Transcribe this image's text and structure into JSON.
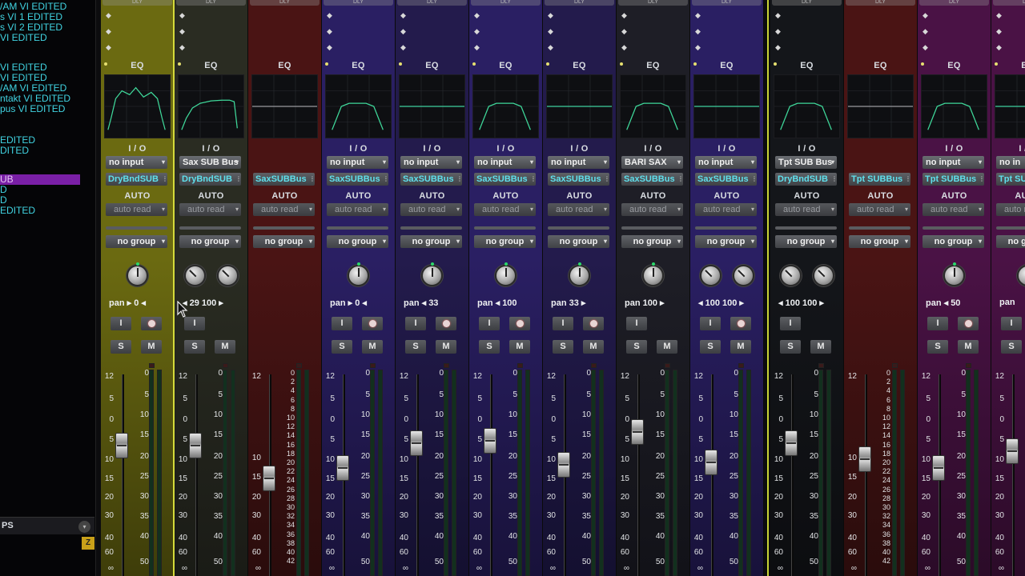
{
  "track_list": {
    "items": [
      {
        "label": "/AM VI EDITED",
        "selected": false
      },
      {
        "label": "s VI 1 EDITED",
        "selected": false
      },
      {
        "label": "s VI 2 EDITED",
        "selected": false
      },
      {
        "label": "VI EDITED",
        "selected": false
      },
      {
        "label": "VI EDITED",
        "selected": false
      },
      {
        "label": "VI EDITED",
        "selected": false
      },
      {
        "label": "/AM VI EDITED",
        "selected": false
      },
      {
        "label": "ntakt VI EDITED",
        "selected": false
      },
      {
        "label": "pus VI EDITED",
        "selected": false
      },
      {
        "label": "",
        "selected": false
      },
      {
        "label": "",
        "selected": false
      },
      {
        "label": "EDITED",
        "selected": false
      },
      {
        "label": "DITED",
        "selected": false
      },
      {
        "label": "",
        "selected": false
      },
      {
        "label": "UB",
        "selected": true
      },
      {
        "label": "D",
        "selected": false
      },
      {
        "label": "D",
        "selected": false
      },
      {
        "label": "EDITED",
        "selected": false
      }
    ],
    "footer_label": "PS",
    "footer_dropdown": "▾",
    "zoom_button": "Z"
  },
  "strings": {
    "eq": "EQ",
    "io": "I / O",
    "auto": "AUTO",
    "auto_read": "auto read",
    "no_group": "no group",
    "input_button": "I",
    "solo": "S",
    "mute": "M",
    "pan_word": "pan",
    "dropdown_arrow": "▾",
    "lock_glyph": "⫶",
    "left_arrow": "‹",
    "right_arrow": "›",
    "bar_label": "DLY"
  },
  "scale_left": [
    "12",
    "5",
    "0",
    "5",
    "10",
    "15",
    "20",
    "30",
    "40",
    "60",
    "∞"
  ],
  "scale_right": [
    "0",
    "5",
    "10",
    "15",
    "20",
    "25",
    "30",
    "35",
    "40",
    "50"
  ],
  "scale_aux": [
    "0",
    "2",
    "4",
    "6",
    "8",
    "10",
    "12",
    "14",
    "16",
    "18",
    "20",
    "22",
    "24",
    "26",
    "28",
    "30",
    "32",
    "34",
    "36",
    "38",
    "40",
    "42"
  ],
  "channels": [
    {
      "id": "c1",
      "bg": "#6b6a11",
      "bg2": "#3e3d0a",
      "input": "no input",
      "bus": "DryBndSUB",
      "knobs": 1,
      "pan": "pan ▸ 0 ◂",
      "fader": 0.42,
      "record": true,
      "solo": true,
      "eq": "m",
      "aux": false
    },
    {
      "id": "c2",
      "bg": "#2a2c22",
      "bg2": "#1a1b16",
      "input": "Sax SUB Bus",
      "bus": "DryBndSUB",
      "knobs": 2,
      "pan": "◂ 29    100 ▸",
      "fader": 0.42,
      "record": false,
      "solo": true,
      "eq": "h",
      "aux": false
    },
    {
      "id": "c3",
      "bg": "#4a1414",
      "bg2": "#2a0c0c",
      "input": "",
      "bus": "SaxSUBBus",
      "knobs": 0,
      "pan": "",
      "fader": 0.66,
      "record": false,
      "solo": false,
      "eq": "f",
      "aux": true
    },
    {
      "id": "c4",
      "bg": "#2a1f63",
      "bg2": "#18123a",
      "input": "no input",
      "bus": "SaxSUBBus",
      "knobs": 1,
      "pan": "pan ▸ 0 ◂",
      "fader": 0.58,
      "record": true,
      "solo": true,
      "eq": "b",
      "aux": false
    },
    {
      "id": "c5",
      "bg": "#231b4c",
      "bg2": "#141030",
      "input": "no input",
      "bus": "SaxSUBBus",
      "knobs": 1,
      "pan": "pan ◂ 33",
      "fader": 0.4,
      "record": true,
      "solo": true,
      "eq": "f",
      "aux": false
    },
    {
      "id": "c6",
      "bg": "#2a1f63",
      "bg2": "#18123a",
      "input": "no input",
      "bus": "SaxSUBBus",
      "knobs": 1,
      "pan": "pan ◂ 100",
      "fader": 0.38,
      "record": true,
      "solo": true,
      "eq": "b",
      "aux": false
    },
    {
      "id": "c7",
      "bg": "#231b4c",
      "bg2": "#141030",
      "input": "no input",
      "bus": "SaxSUBBus",
      "knobs": 1,
      "pan": "pan   33 ▸",
      "fader": 0.56,
      "record": true,
      "solo": true,
      "eq": "f",
      "aux": false
    },
    {
      "id": "c8",
      "bg": "#1e1e26",
      "bg2": "#121218",
      "input": "BARI SAX",
      "bus": "SaxSUBBus",
      "knobs": 1,
      "pan": "pan   100 ▸",
      "fader": 0.32,
      "record": false,
      "solo": true,
      "eq": "b",
      "aux": false
    },
    {
      "id": "c9",
      "bg": "#2a1f63",
      "bg2": "#18123a",
      "input": "no input",
      "bus": "SaxSUBBus",
      "knobs": 2,
      "pan": "◂ 100  100 ▸",
      "fader": 0.54,
      "record": true,
      "solo": true,
      "eq": "f",
      "aux": false
    },
    {
      "id": "c10",
      "bg": "#14161a",
      "bg2": "#0c0d10",
      "input": "Tpt SUB Bus",
      "bus": "DryBndSUB",
      "knobs": 2,
      "pan": "◂ 100  100 ▸",
      "fader": 0.4,
      "record": false,
      "solo": true,
      "eq": "b",
      "aux": false
    },
    {
      "id": "c11",
      "bg": "#4a1414",
      "bg2": "#2a0c0c",
      "input": "",
      "bus": "Tpt SUBBus",
      "knobs": 0,
      "pan": "",
      "fader": 0.52,
      "record": false,
      "solo": false,
      "eq": "f",
      "aux": true
    },
    {
      "id": "c12",
      "bg": "#4a1245",
      "bg2": "#2b0b28",
      "input": "no input",
      "bus": "Tpt SUBBus",
      "knobs": 1,
      "pan": "pan ◂ 50",
      "fader": 0.58,
      "record": true,
      "solo": true,
      "eq": "b",
      "aux": false
    },
    {
      "id": "c13",
      "bg": "#4a1245",
      "bg2": "#2b0b28",
      "input": "no in",
      "bus": "Tpt SUI",
      "knobs": 1,
      "pan": "pan",
      "fader": 0.46,
      "record": false,
      "solo": true,
      "eq": "f",
      "aux": false
    }
  ]
}
